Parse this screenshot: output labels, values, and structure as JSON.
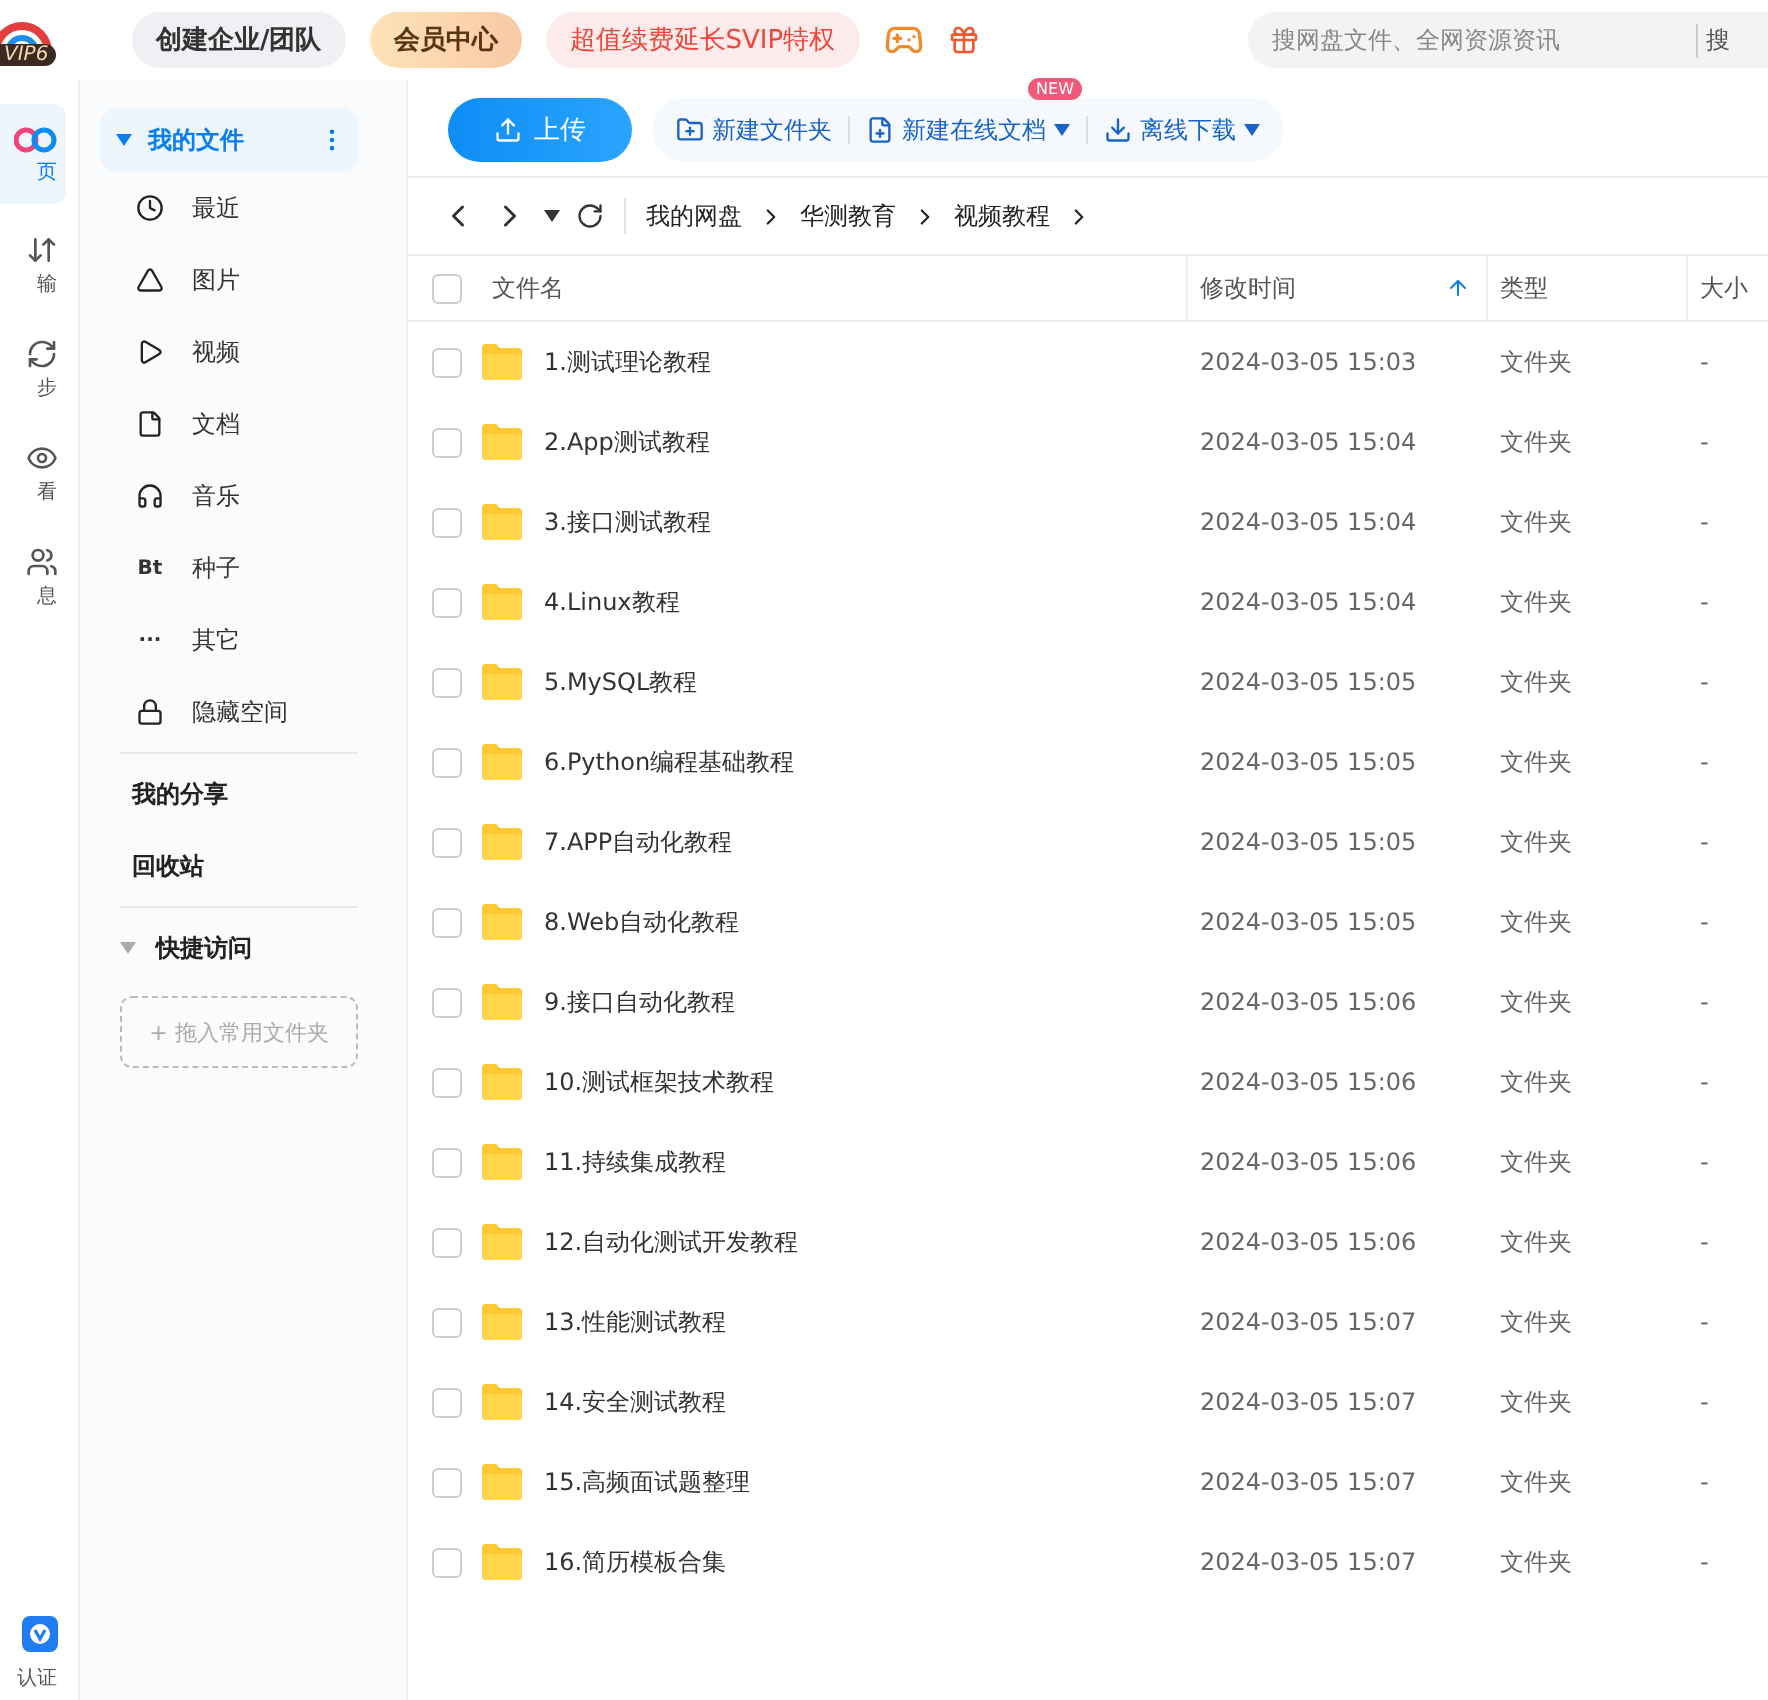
{
  "topbar": {
    "logo_badge": "VIP6",
    "buttons": [
      {
        "label": "创建企业/团队",
        "kind": "plain"
      },
      {
        "label": "会员中心",
        "kind": "vip"
      },
      {
        "label": "超值续费延长SVIP特权",
        "kind": "promo"
      }
    ],
    "search": {
      "placeholder": "搜网盘文件、全网资源资讯",
      "button": "搜"
    }
  },
  "rail": {
    "items": [
      {
        "label": "页",
        "selected": true
      },
      {
        "label": "输",
        "selected": false
      },
      {
        "label": "步",
        "selected": false
      },
      {
        "label": "看",
        "selected": false
      },
      {
        "label": "息",
        "selected": false
      }
    ],
    "bottom": {
      "label": "认证"
    }
  },
  "sidebar": {
    "root": {
      "label": "我的文件",
      "expanded": true,
      "selected": true
    },
    "items": [
      {
        "label": "最近"
      },
      {
        "label": "图片"
      },
      {
        "label": "视频"
      },
      {
        "label": "文档"
      },
      {
        "label": "音乐"
      },
      {
        "label": "种子",
        "glyph": "Bt"
      },
      {
        "label": "其它",
        "glyph": "···"
      },
      {
        "label": "隐藏空间"
      }
    ],
    "links": [
      "我的分享",
      "回收站"
    ],
    "quick": {
      "label": "快捷访问",
      "expanded": true,
      "drop_hint": "+ 拖入常用文件夹"
    }
  },
  "toolbar": {
    "upload": "上传",
    "actions": [
      {
        "label": "新建文件夹",
        "dropdown": false
      },
      {
        "label": "新建在线文档",
        "dropdown": true,
        "badge": "NEW"
      },
      {
        "label": "离线下载",
        "dropdown": true
      }
    ]
  },
  "breadcrumb": [
    "我的网盘",
    "华测教育",
    "视频教程"
  ],
  "table": {
    "all_checked": false,
    "columns": [
      {
        "label": "文件名",
        "sorted": false
      },
      {
        "label": "修改时间",
        "sorted": true
      },
      {
        "label": "类型",
        "sorted": false
      },
      {
        "label": "大小",
        "sorted": false
      }
    ],
    "rows": [
      {
        "name": "1.测试理论教程",
        "modified": "2024-03-05 15:03",
        "type": "文件夹",
        "size": "-",
        "checked": false
      },
      {
        "name": "2.App测试教程",
        "modified": "2024-03-05 15:04",
        "type": "文件夹",
        "size": "-",
        "checked": false
      },
      {
        "name": "3.接口测试教程",
        "modified": "2024-03-05 15:04",
        "type": "文件夹",
        "size": "-",
        "checked": false
      },
      {
        "name": "4.Linux教程",
        "modified": "2024-03-05 15:04",
        "type": "文件夹",
        "size": "-",
        "checked": false
      },
      {
        "name": "5.MySQL教程",
        "modified": "2024-03-05 15:05",
        "type": "文件夹",
        "size": "-",
        "checked": false
      },
      {
        "name": "6.Python编程基础教程",
        "modified": "2024-03-05 15:05",
        "type": "文件夹",
        "size": "-",
        "checked": false
      },
      {
        "name": "7.APP自动化教程",
        "modified": "2024-03-05 15:05",
        "type": "文件夹",
        "size": "-",
        "checked": false
      },
      {
        "name": "8.Web自动化教程",
        "modified": "2024-03-05 15:05",
        "type": "文件夹",
        "size": "-",
        "checked": false
      },
      {
        "name": "9.接口自动化教程",
        "modified": "2024-03-05 15:06",
        "type": "文件夹",
        "size": "-",
        "checked": false
      },
      {
        "name": "10.测试框架技术教程",
        "modified": "2024-03-05 15:06",
        "type": "文件夹",
        "size": "-",
        "checked": false
      },
      {
        "name": "11.持续集成教程",
        "modified": "2024-03-05 15:06",
        "type": "文件夹",
        "size": "-",
        "checked": false
      },
      {
        "name": "12.自动化测试开发教程",
        "modified": "2024-03-05 15:06",
        "type": "文件夹",
        "size": "-",
        "checked": false
      },
      {
        "name": "13.性能测试教程",
        "modified": "2024-03-05 15:07",
        "type": "文件夹",
        "size": "-",
        "checked": false
      },
      {
        "name": "14.安全测试教程",
        "modified": "2024-03-05 15:07",
        "type": "文件夹",
        "size": "-",
        "checked": false
      },
      {
        "name": "15.高频面试题整理",
        "modified": "2024-03-05 15:07",
        "type": "文件夹",
        "size": "-",
        "checked": false
      },
      {
        "name": "16.简历模板合集",
        "modified": "2024-03-05 15:07",
        "type": "文件夹",
        "size": "-",
        "checked": false
      }
    ]
  }
}
